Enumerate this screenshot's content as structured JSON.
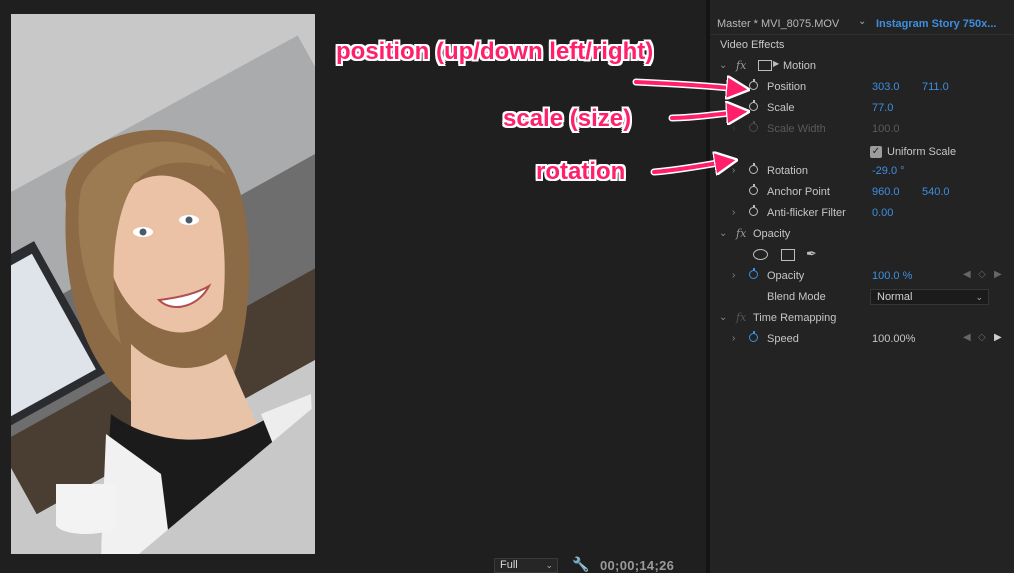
{
  "monitor": {
    "zoom_value": "Full",
    "timecode": "00;00;14;26",
    "icons": {
      "settings": "wrench-icon",
      "zoom_dropdown": "chevron-down-icon"
    }
  },
  "panel": {
    "clip_tab": "Master * MVI_8075.MOV",
    "sequence_tab": "Instagram Story 750x...",
    "section_label": "Video Effects",
    "motion": {
      "name": "Motion",
      "position": {
        "label": "Position",
        "x": "303.0",
        "y": "711.0"
      },
      "scale": {
        "label": "Scale",
        "value": "77.0"
      },
      "scale_width": {
        "label": "Scale Width",
        "value": "100.0"
      },
      "uniform_scale": {
        "label": "Uniform Scale",
        "checked": true
      },
      "rotation": {
        "label": "Rotation",
        "value": "-29.0 °"
      },
      "anchor_point": {
        "label": "Anchor Point",
        "x": "960.0",
        "y": "540.0"
      },
      "anti_flicker": {
        "label": "Anti-flicker Filter",
        "value": "0.00"
      }
    },
    "opacity": {
      "name": "Opacity",
      "opacity_param": {
        "label": "Opacity",
        "value": "100.0 %"
      },
      "blend_mode": {
        "label": "Blend Mode",
        "value": "Normal"
      }
    },
    "time_remapping": {
      "name": "Time Remapping",
      "speed": {
        "label": "Speed",
        "value": "100.00%"
      }
    }
  },
  "annotations": {
    "position_note": "position (up/down left/right)",
    "scale_note": "scale (size)",
    "rotation_note": "rotation"
  },
  "colors": {
    "accent_blue": "#3e8fe0",
    "annotation_pink": "#ff1f6b",
    "panel_bg": "#232323",
    "monitor_bg": "#1f1f1f"
  }
}
